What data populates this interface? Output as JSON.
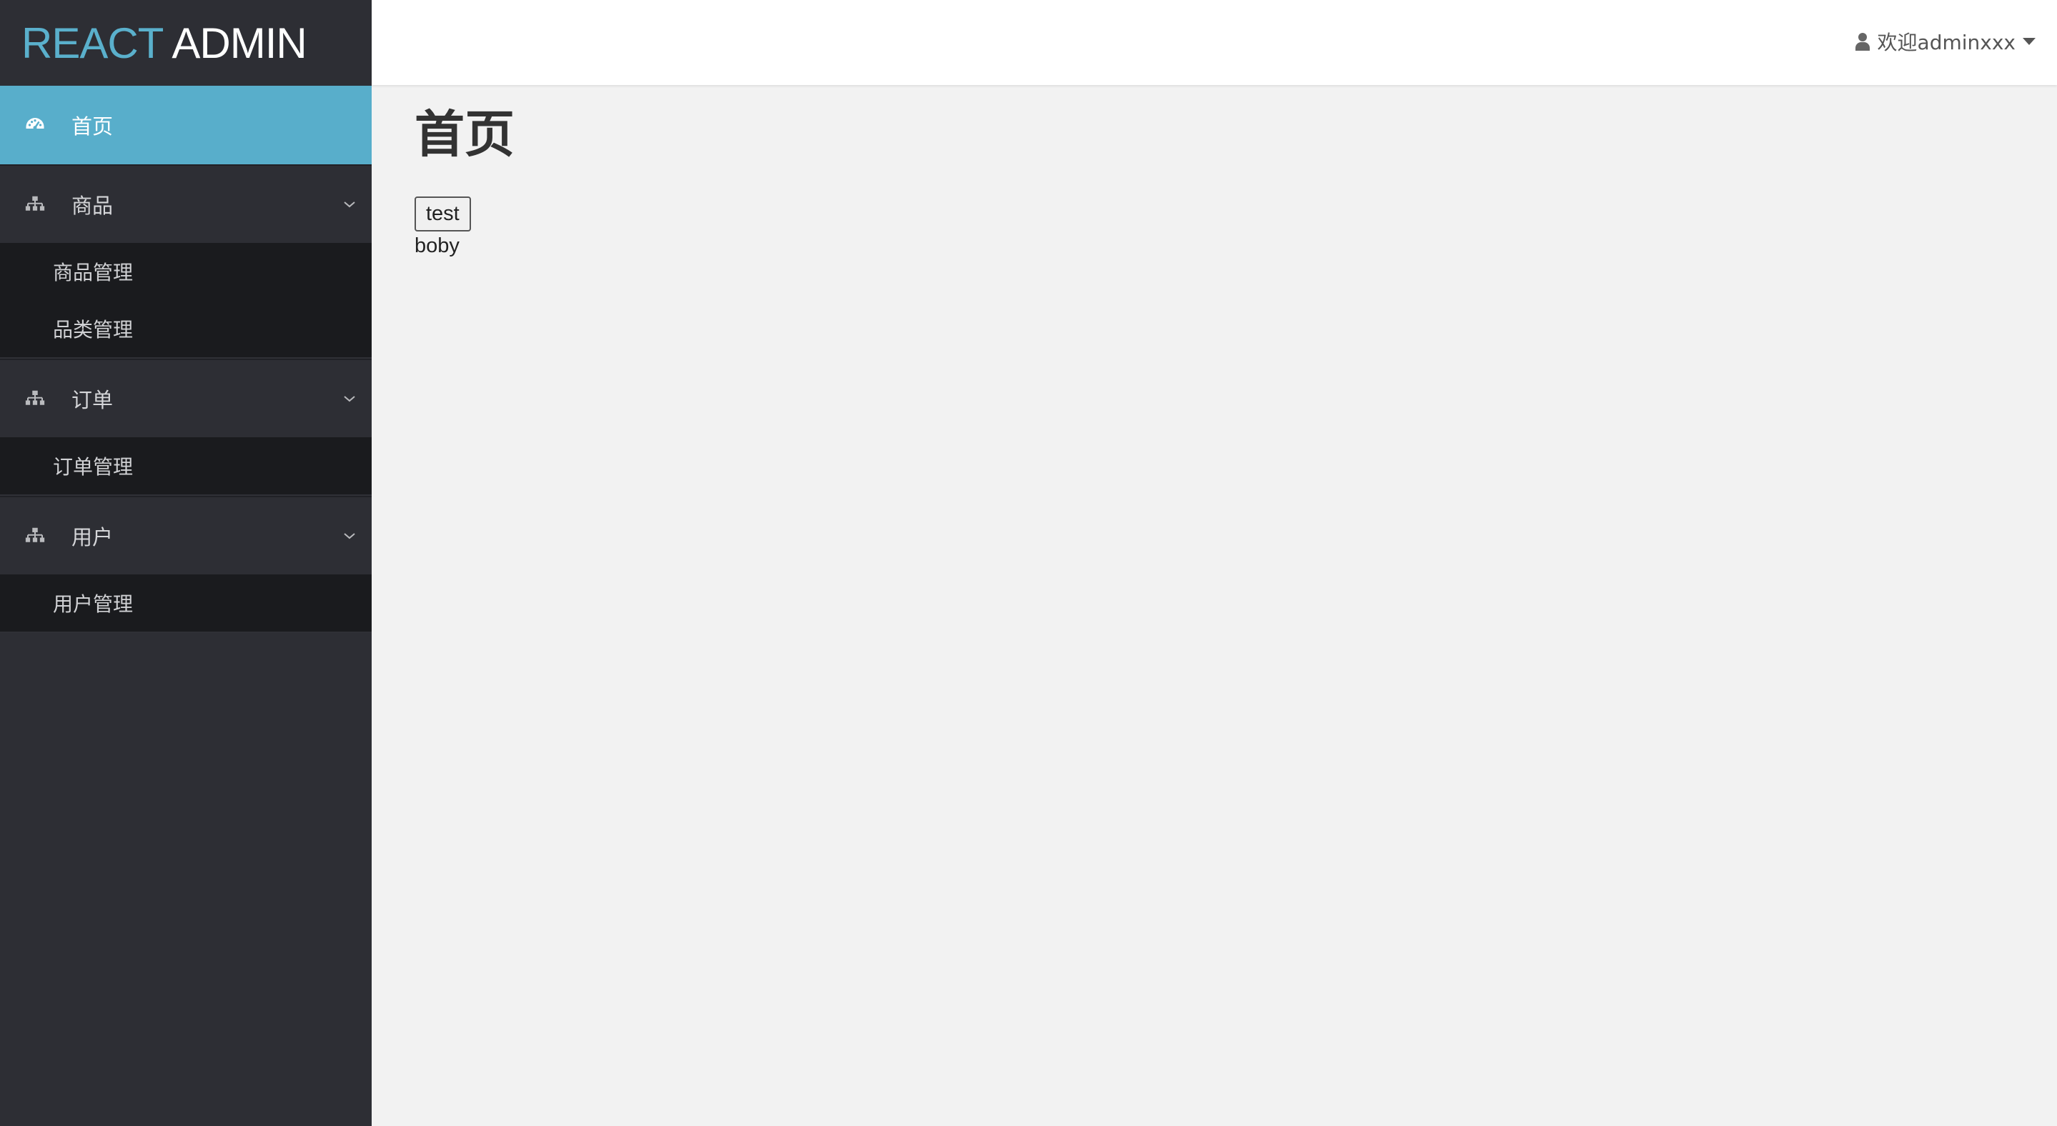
{
  "logo": {
    "part1": "REACT",
    "part2": "ADMIN"
  },
  "sidebar": {
    "home": {
      "label": "首页",
      "icon": "dashboard-icon"
    },
    "groups": [
      {
        "label": "商品",
        "icon": "sitemap-icon",
        "items": [
          "商品管理",
          "品类管理"
        ]
      },
      {
        "label": "订单",
        "icon": "sitemap-icon",
        "items": [
          "订单管理"
        ]
      },
      {
        "label": "用户",
        "icon": "sitemap-icon",
        "items": [
          "用户管理"
        ]
      }
    ]
  },
  "header": {
    "welcome": "欢迎adminxxx",
    "icon": "user-icon"
  },
  "main": {
    "title": "首页",
    "button_label": "test",
    "text": "boby"
  },
  "colors": {
    "accent": "#58aecb",
    "sidebar_bg": "#2d2e34",
    "submenu_bg": "#1a1b1e",
    "content_bg": "#f2f2f2"
  }
}
